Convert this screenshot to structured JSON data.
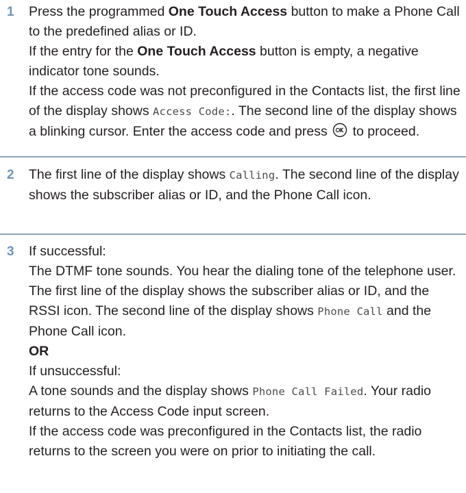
{
  "steps": [
    {
      "number": "1",
      "lines": {
        "l1_pre": "Press the programmed ",
        "l1_bold": "One Touch Access",
        "l1_post": " button to make a Phone Call to the predefined alias or ID.",
        "l2_pre": "If the entry for the ",
        "l2_bold": "One Touch Access",
        "l2_post": " button is empty, a negative indicator tone sounds.",
        "l3_pre": "If the access code was not preconfigured in the Contacts list, the first line of the display shows ",
        "l3_mono": "Access Code:",
        "l3_post": ". The second line of the display shows a blinking cursor. Enter the access code and press ",
        "l3_end": " to proceed."
      }
    },
    {
      "number": "2",
      "lines": {
        "l1_pre": "The first line of the display shows ",
        "l1_mono": "Calling",
        "l1_post": ". The second line of the display shows the subscriber alias or ID, and the Phone Call icon."
      }
    },
    {
      "number": "3",
      "lines": {
        "success": "If successful:",
        "s1_pre": "The DTMF tone sounds. You hear the dialing tone of the telephone user. The first line of the display shows the subscriber alias or ID, and the RSSI icon. The second line of the display shows ",
        "s1_mono": "Phone Call",
        "s1_post": " and the Phone Call icon.",
        "or": "OR",
        "fail": "If unsuccessful:",
        "f1_pre": "A tone sounds and the display shows ",
        "f1_mono": "Phone Call Failed",
        "f1_post": ". Your radio returns to the Access Code input screen.",
        "f2": "If the access code was preconfigured in the Contacts list, the radio returns to the screen you were on prior to initiating the call."
      }
    }
  ],
  "icons": {
    "ok_button": "ok-button-icon"
  },
  "colors": {
    "step_number": "#7294b6",
    "divider": "#8fa7bd",
    "text": "#231f20"
  }
}
